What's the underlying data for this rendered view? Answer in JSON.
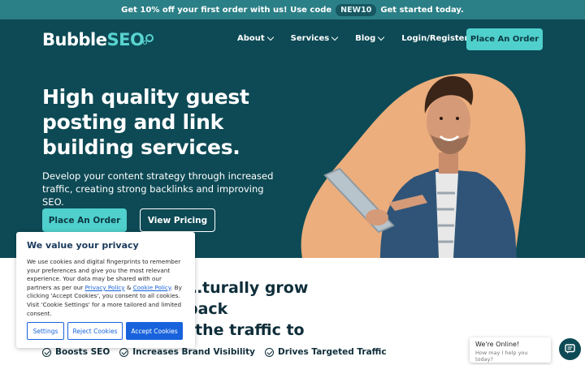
{
  "promo": {
    "text_before": "Get 10% off your first order with us! Use code",
    "code": "NEW10",
    "text_after": "Get started today."
  },
  "logo": {
    "part1": "Bubble",
    "part2": "SEO"
  },
  "nav": {
    "items": [
      {
        "label": "About"
      },
      {
        "label": "Services"
      },
      {
        "label": "Blog"
      },
      {
        "label": "Login/Register"
      }
    ],
    "cta": "Place An Order"
  },
  "hero": {
    "headline": "High quality guest posting and link building services.",
    "subtext": "Develop your content strategy through increased traffic, creating strong backlinks and improving SEO.",
    "primary_button": "Place An Order",
    "secondary_button": "View Pricing"
  },
  "section": {
    "title_line1": "…turally grow back",
    "title_line2": "the traffic to"
  },
  "benefits": [
    {
      "label": "Boosts SEO"
    },
    {
      "label": "Increases Brand Visibility"
    },
    {
      "label": "Drives Targeted Traffic"
    }
  ],
  "cookie": {
    "title": "We value your privacy",
    "body_part1": "We use cookies and digital fingerprints to remember your preferences and give you the most relevant experience. Your data may be shared with our partners as per our",
    "privacy_link": "Privacy Policy",
    "amp": "&",
    "cookie_link": "Cookie Policy",
    "body_part2": ". By clicking 'Accept Cookies', you consent to all cookies. Visit 'Cookie Settings' for a more tailored and limited consent.",
    "settings": "Settings",
    "reject": "Reject Cookies",
    "accept": "Accept Cookies"
  },
  "chat": {
    "title": "We're Online!",
    "subtitle": "How may I help you today?"
  },
  "colors": {
    "hero_bg": "#0d4a55",
    "accent": "#4fd0cc",
    "promo_bg": "#2b7f86",
    "blob": "#ecae7d",
    "cookie_accept": "#1863dc"
  }
}
